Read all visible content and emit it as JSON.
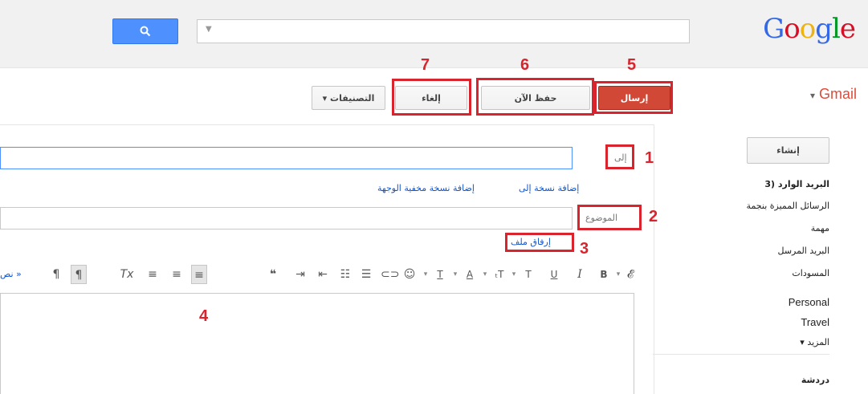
{
  "header": {
    "logo": "Google",
    "search": {
      "value": "",
      "placeholder": "",
      "caret": "▼",
      "button_icon": "search-icon"
    }
  },
  "toolbar": {
    "gmail_label": "Gmail",
    "gmail_caret": "▾",
    "send_label": "إرسال",
    "save_label": "حفظ الآن",
    "discard_label": "إلغاء",
    "labels_label": "التصنيفات ▾"
  },
  "nav": {
    "compose_label": "إنشاء",
    "items": [
      {
        "label": "البريد الوارد (3",
        "bold": true
      },
      {
        "label": "الرسائل المميزة بنجمة"
      },
      {
        "label": "مهمة"
      },
      {
        "label": "البريد المرسل"
      },
      {
        "label": "المسودات"
      },
      {
        "label": "Personal"
      },
      {
        "label": "Travel"
      },
      {
        "label": "المزيد ▾"
      }
    ],
    "chat_label": "دردشة"
  },
  "compose": {
    "to_label": "إلى",
    "to_value": "",
    "add_cc": "إضافة نسخة إلى",
    "add_bcc": "إضافة نسخة مخفية الوجهة",
    "subject_label": "الموضوع",
    "subject_value": "",
    "attach_label": "إرفاق ملف",
    "plain_text_link": "« نص",
    "body_value": ""
  },
  "annotations": [
    "1",
    "2",
    "3",
    "4",
    "5",
    "6",
    "7"
  ],
  "colors": {
    "accent": "#4d90fe",
    "send": "#d14836",
    "annotation": "#d9232d",
    "link": "#1155cc"
  }
}
